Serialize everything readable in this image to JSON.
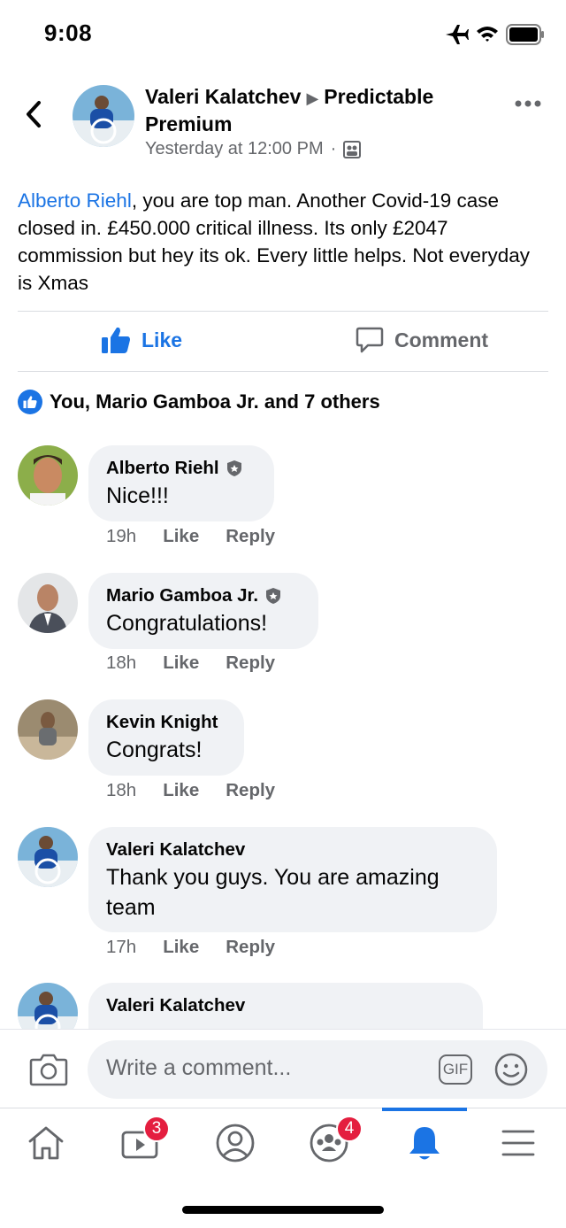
{
  "status": {
    "time": "9:08"
  },
  "post": {
    "author": "Valeri Kalatchev",
    "group": "Predictable Premium",
    "timestamp": "Yesterday at 12:00 PM",
    "separator": "·",
    "tag": "Alberto Riehl",
    "text": ", you are top man. Another Covid-19 case closed in. £450.000 critical illness. Its only £2047 commission but hey its ok. Every little helps. Not everyday is Xmas"
  },
  "actions": {
    "like": "Like",
    "comment": "Comment"
  },
  "reactions": {
    "summary": "You, Mario Gamboa Jr. and 7 others"
  },
  "comments": [
    {
      "name": "Alberto Riehl",
      "text": "Nice!!!",
      "time": "19h",
      "like": "Like",
      "reply": "Reply",
      "badge": true
    },
    {
      "name": "Mario Gamboa Jr.",
      "text": "Congratulations!",
      "time": "18h",
      "like": "Like",
      "reply": "Reply",
      "badge": true
    },
    {
      "name": "Kevin Knight",
      "text": "Congrats!",
      "time": "18h",
      "like": "Like",
      "reply": "Reply",
      "badge": false
    },
    {
      "name": "Valeri Kalatchev",
      "text": "Thank you  guys. You are amazing team",
      "time": "17h",
      "like": "Like",
      "reply": "Reply",
      "badge": false
    },
    {
      "name": "Valeri Kalatchev",
      "text": "",
      "badge": false
    }
  ],
  "composer": {
    "placeholder": "Write a comment...",
    "gif": "GIF"
  },
  "tabs": {
    "watch_badge": "3",
    "groups_badge": "4"
  },
  "colors": {
    "accent": "#1b74e4",
    "badge": "#e41e3f"
  }
}
